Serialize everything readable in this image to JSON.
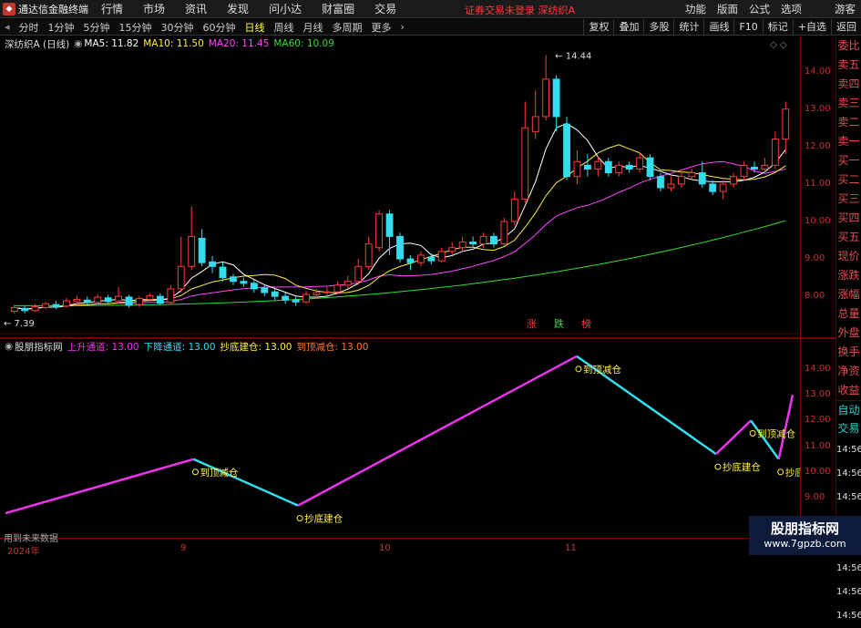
{
  "app": {
    "name": "通达信金融终端",
    "menu": [
      "行情",
      "市场",
      "资讯",
      "发现",
      "问小达",
      "财富圈",
      "交易"
    ],
    "notice": "证券交易未登录  深纺织A",
    "right_menu": [
      "功能",
      "版面",
      "公式",
      "选项"
    ],
    "guest": "游客"
  },
  "periods": {
    "items": [
      "分时",
      "1分钟",
      "5分钟",
      "15分钟",
      "30分钟",
      "60分钟",
      "日线",
      "周线",
      "月线",
      "多周期",
      "更多"
    ],
    "active": 6,
    "tools": [
      "复权",
      "叠加",
      "多股",
      "统计",
      "画线",
      "F10",
      "标记",
      "+自选",
      "返回"
    ]
  },
  "main_legend": {
    "title": "深纺织A (日线)",
    "ma5": "MA5: 11.82",
    "ma10": "MA10: 11.50",
    "ma20": "MA20: 11.45",
    "ma60": "MA60: 10.09"
  },
  "sub_legend": {
    "title": "股朋指标网",
    "up": "上升通道: 13.00",
    "down": "下降通道: 13.00",
    "buy": "抄底建仓: 13.00",
    "sell": "到顶减仓: 13.00"
  },
  "right_panel": [
    "委比",
    "卖五",
    "卖四",
    "卖三",
    "卖二",
    "卖一",
    "买一",
    "买二",
    "买三",
    "买四",
    "买五",
    "现价",
    "涨跌",
    "涨幅",
    "总量",
    "外盘",
    "换手",
    "净资",
    "收益",
    "自动",
    "交易",
    "14:56",
    "14:56",
    "14:56",
    "14:56",
    "14:56",
    "14:56",
    "14:56",
    "14:56"
  ],
  "chart_data": [
    {
      "type": "candlestick",
      "ylim": [
        7.2,
        14.6
      ],
      "yticks": [
        "14.00",
        "13.00",
        "12.00",
        "11.00",
        "10.00",
        "9.00",
        "8.00"
      ],
      "annotations": {
        "high": "14.44",
        "low": "7.39",
        "markers": [
          "涨",
          "跌",
          "榜"
        ]
      },
      "series_names": [
        "MA5",
        "MA10",
        "MA20",
        "MA60"
      ],
      "colors": {
        "up": "#ff3b3b",
        "down": "#33ddee",
        "ma5": "#ffffff",
        "ma10": "#ffee44",
        "ma20": "#ff44ff",
        "ma60": "#33dd33"
      },
      "candles": [
        [
          7.6,
          7.7,
          7.78,
          7.55
        ],
        [
          7.68,
          7.62,
          7.74,
          7.55
        ],
        [
          7.62,
          7.72,
          7.8,
          7.58
        ],
        [
          7.7,
          7.8,
          7.86,
          7.66
        ],
        [
          7.78,
          7.72,
          7.88,
          7.66
        ],
        [
          7.74,
          7.88,
          7.95,
          7.7
        ],
        [
          7.86,
          7.92,
          8.02,
          7.8
        ],
        [
          7.9,
          7.84,
          8.0,
          7.78
        ],
        [
          7.84,
          7.98,
          8.06,
          7.8
        ],
        [
          7.96,
          7.86,
          8.04,
          7.8
        ],
        [
          7.88,
          8.0,
          8.25,
          7.82
        ],
        [
          7.98,
          7.76,
          8.04,
          7.7
        ],
        [
          7.78,
          7.94,
          8.0,
          7.72
        ],
        [
          7.92,
          8.02,
          8.08,
          7.86
        ],
        [
          8.0,
          7.82,
          8.08,
          7.76
        ],
        [
          7.84,
          8.2,
          8.3,
          7.8
        ],
        [
          8.2,
          8.8,
          9.6,
          8.1
        ],
        [
          8.8,
          9.6,
          10.4,
          8.7
        ],
        [
          9.55,
          8.9,
          9.8,
          8.8
        ],
        [
          8.92,
          8.8,
          9.08,
          8.62
        ],
        [
          8.78,
          8.5,
          8.9,
          8.4
        ],
        [
          8.52,
          8.4,
          8.6,
          8.3
        ],
        [
          8.4,
          8.35,
          8.5,
          8.25
        ],
        [
          8.35,
          8.2,
          8.44,
          8.1
        ],
        [
          8.22,
          8.1,
          8.3,
          8.0
        ],
        [
          8.12,
          8.0,
          8.2,
          7.9
        ],
        [
          8.0,
          7.9,
          8.1,
          7.8
        ],
        [
          7.9,
          7.85,
          8.0,
          7.75
        ],
        [
          7.85,
          8.05,
          8.15,
          7.8
        ],
        [
          8.04,
          8.1,
          8.2,
          7.96
        ],
        [
          8.1,
          8.12,
          8.25,
          8.02
        ],
        [
          8.12,
          8.3,
          8.4,
          8.05
        ],
        [
          8.3,
          8.4,
          8.55,
          8.2
        ],
        [
          8.4,
          8.8,
          9.0,
          8.3
        ],
        [
          8.8,
          9.4,
          9.6,
          8.7
        ],
        [
          9.3,
          10.2,
          10.3,
          9.2
        ],
        [
          10.2,
          9.6,
          10.3,
          9.1
        ],
        [
          9.6,
          9.0,
          9.7,
          8.9
        ],
        [
          9.0,
          8.9,
          9.1,
          8.7
        ],
        [
          8.9,
          9.1,
          9.2,
          8.8
        ],
        [
          9.05,
          8.95,
          9.15,
          8.85
        ],
        [
          8.95,
          9.2,
          9.3,
          8.9
        ],
        [
          9.2,
          9.3,
          9.45,
          9.1
        ],
        [
          9.3,
          9.45,
          9.6,
          9.2
        ],
        [
          9.45,
          9.4,
          9.6,
          9.3
        ],
        [
          9.4,
          9.6,
          9.7,
          9.3
        ],
        [
          9.6,
          9.4,
          9.7,
          9.3
        ],
        [
          9.4,
          10.0,
          10.1,
          9.35
        ],
        [
          10.0,
          10.6,
          10.8,
          9.9
        ],
        [
          10.6,
          12.5,
          13.2,
          10.5
        ],
        [
          12.4,
          12.8,
          13.5,
          12.2
        ],
        [
          12.8,
          13.8,
          14.44,
          12.7
        ],
        [
          13.8,
          12.8,
          13.9,
          12.4
        ],
        [
          12.6,
          11.2,
          12.8,
          11.1
        ],
        [
          11.2,
          11.6,
          11.9,
          11.0
        ],
        [
          11.5,
          11.4,
          11.8,
          11.2
        ],
        [
          11.4,
          11.6,
          11.75,
          11.2
        ],
        [
          11.6,
          11.3,
          11.7,
          11.2
        ],
        [
          11.3,
          11.5,
          11.6,
          11.2
        ],
        [
          11.5,
          11.4,
          11.6,
          11.3
        ],
        [
          11.4,
          11.7,
          11.85,
          11.3
        ],
        [
          11.7,
          11.2,
          11.8,
          11.1
        ],
        [
          11.2,
          10.9,
          11.3,
          10.8
        ],
        [
          10.9,
          11.0,
          11.2,
          10.8
        ],
        [
          11.0,
          11.2,
          11.35,
          10.9
        ],
        [
          11.2,
          11.3,
          11.4,
          11.1
        ],
        [
          11.3,
          11.0,
          11.6,
          10.9
        ],
        [
          11.0,
          10.8,
          11.1,
          10.7
        ],
        [
          10.8,
          11.0,
          11.1,
          10.6
        ],
        [
          11.0,
          11.2,
          11.3,
          10.9
        ],
        [
          11.2,
          11.5,
          11.6,
          11.1
        ],
        [
          11.45,
          11.4,
          11.6,
          11.3
        ],
        [
          11.4,
          11.5,
          11.7,
          11.3
        ],
        [
          11.5,
          12.2,
          12.4,
          11.4
        ],
        [
          12.2,
          13.0,
          13.2,
          11.8
        ]
      ]
    },
    {
      "type": "line",
      "ylim": [
        7.8,
        14.6
      ],
      "yticks": [
        "14.00",
        "13.00",
        "12.00",
        "11.00",
        "10.00",
        "9.00",
        "8.00"
      ],
      "series_names": [
        "上升通道",
        "下降通道"
      ],
      "x": [
        0,
        27,
        42,
        82,
        102,
        107,
        111,
        113
      ],
      "values": [
        8.4,
        10.5,
        8.7,
        14.5,
        10.7,
        12.0,
        10.5,
        13.0
      ],
      "segment_colors": [
        "#ee33ee",
        "#33ddee",
        "#ee33ee",
        "#33ddee",
        "#ee33ee",
        "#33ddee",
        "#ee33ee"
      ],
      "labels": [
        {
          "text": "到顶减仓",
          "x": 27,
          "y": 10.5,
          "pos": "below"
        },
        {
          "text": "抄底建仓",
          "x": 42,
          "y": 8.7,
          "pos": "below"
        },
        {
          "text": "到顶减仓",
          "x": 82,
          "y": 14.5,
          "pos": "below"
        },
        {
          "text": "抄底建仓",
          "x": 102,
          "y": 10.7,
          "pos": "below"
        },
        {
          "text": "到顶减仓",
          "x": 107,
          "y": 12.0,
          "pos": "below"
        },
        {
          "text": "抄底建仓",
          "x": 111,
          "y": 10.5,
          "pos": "below"
        }
      ],
      "xticks": [
        "2024年",
        "9",
        "10",
        "11"
      ],
      "footer": "用到未来数据"
    }
  ],
  "watermark": {
    "line1": "股朋指标网",
    "line2": "www.7gpzb.com"
  }
}
